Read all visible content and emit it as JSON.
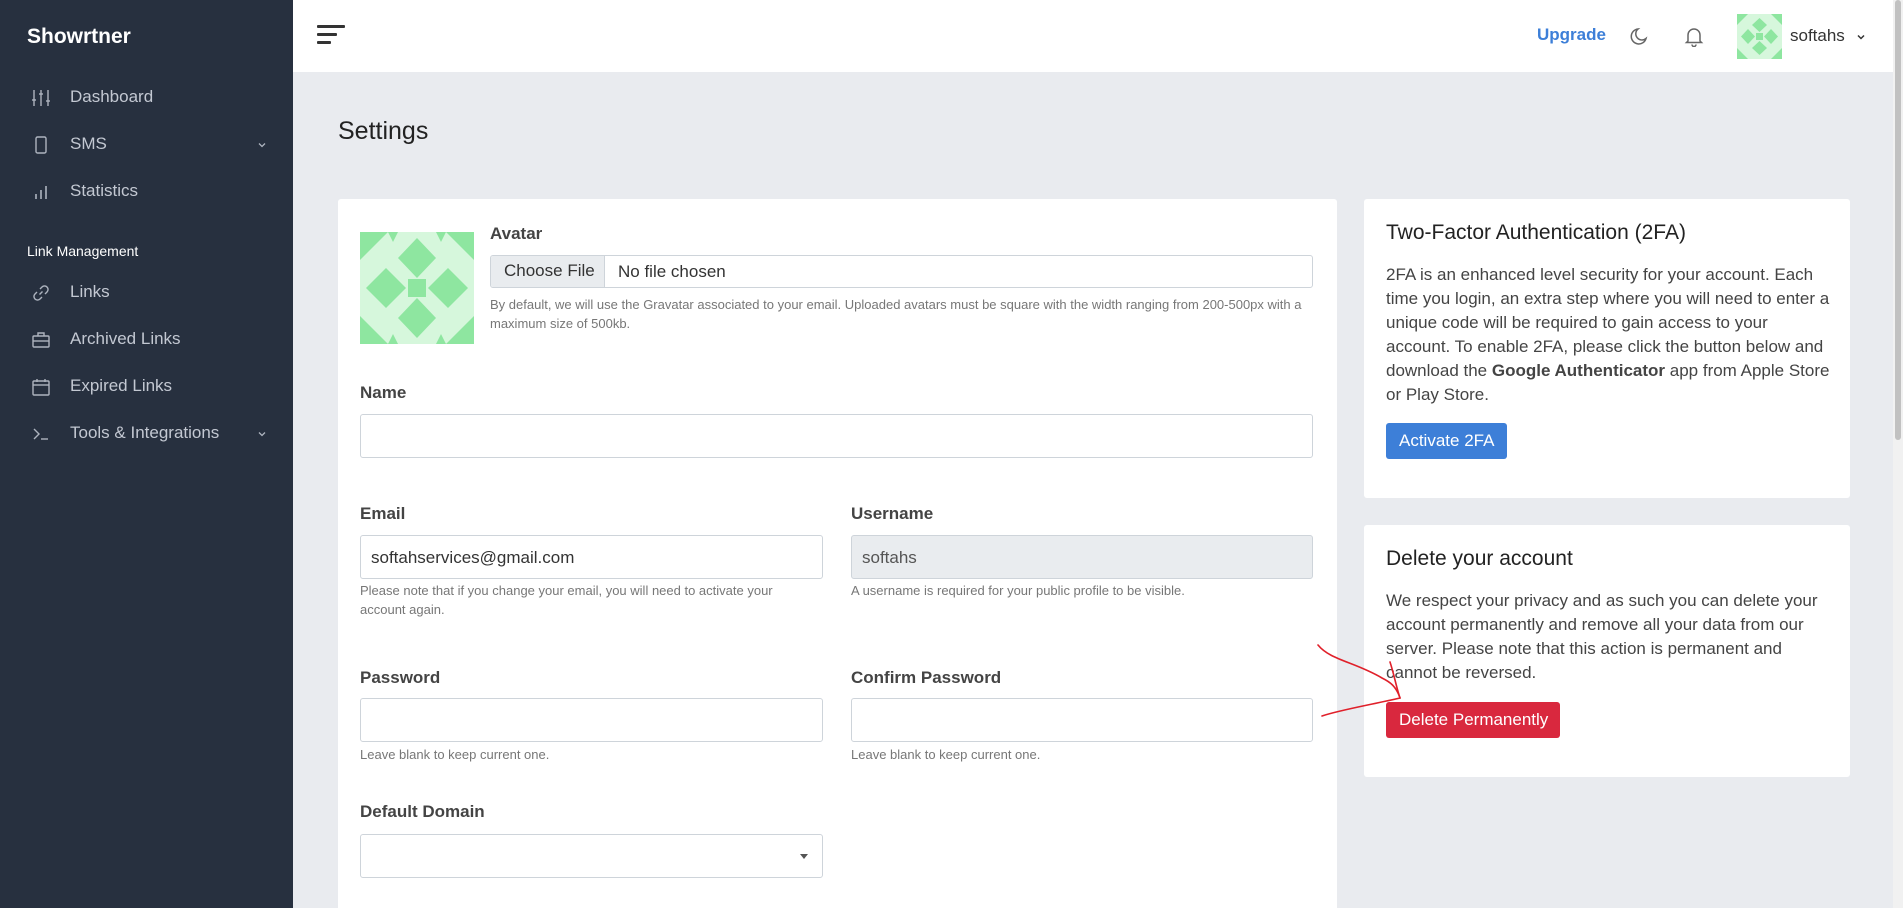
{
  "sidebar": {
    "brand": "Showrtner",
    "items": [
      {
        "label": "Dashboard",
        "icon": "sliders-icon"
      },
      {
        "label": "SMS",
        "icon": "phone-icon"
      },
      {
        "label": "Statistics",
        "icon": "bar-chart-icon"
      }
    ],
    "section_label": "Link Management",
    "link_items": [
      {
        "label": "Links",
        "icon": "link-icon"
      },
      {
        "label": "Archived Links",
        "icon": "archive-icon"
      },
      {
        "label": "Expired Links",
        "icon": "calendar-icon"
      },
      {
        "label": "Tools & Integrations",
        "icon": "terminal-icon"
      }
    ]
  },
  "topbar": {
    "upgrade_label": "Upgrade",
    "user_name": "softahs"
  },
  "page": {
    "title": "Settings"
  },
  "profile_form": {
    "avatar_label": "Avatar",
    "file_button": "Choose File",
    "file_status": "No file chosen",
    "avatar_help": "By default, we will use the Gravatar associated to your email. Uploaded avatars must be square with the width ranging from 200-500px with a maximum size of 500kb.",
    "name_label": "Name",
    "name_value": "",
    "email_label": "Email",
    "email_value": "softahservices@gmail.com",
    "email_help": "Please note that if you change your email, you will need to activate your account again.",
    "username_label": "Username",
    "username_value": "softahs",
    "username_help": "A username is required for your public profile to be visible.",
    "password_label": "Password",
    "password_help": "Leave blank to keep current one.",
    "confirm_label": "Confirm Password",
    "confirm_help": "Leave blank to keep current one.",
    "domain_label": "Default Domain",
    "domain_value": ""
  },
  "two_factor": {
    "title": "Two-Factor Authentication (2FA)",
    "text_before": "2FA is an enhanced level security for your account. Each time you login, an extra step where you will need to enter a unique code will be required to gain access to your account. To enable 2FA, please click the button below and download the ",
    "text_bold": "Google Authenticator",
    "text_after": " app from Apple Store or Play Store.",
    "button": "Activate 2FA"
  },
  "delete_account": {
    "title": "Delete your account",
    "text": "We respect your privacy and as such you can delete your account permanently and remove all your data from our server. Please note that this action is permanent and cannot be reversed.",
    "button": "Delete Permanently"
  },
  "colors": {
    "sidebar_bg": "#27303f",
    "accent_blue": "#3d7fd8",
    "danger_red": "#d9283e",
    "annotation_red": "#e0202a"
  }
}
